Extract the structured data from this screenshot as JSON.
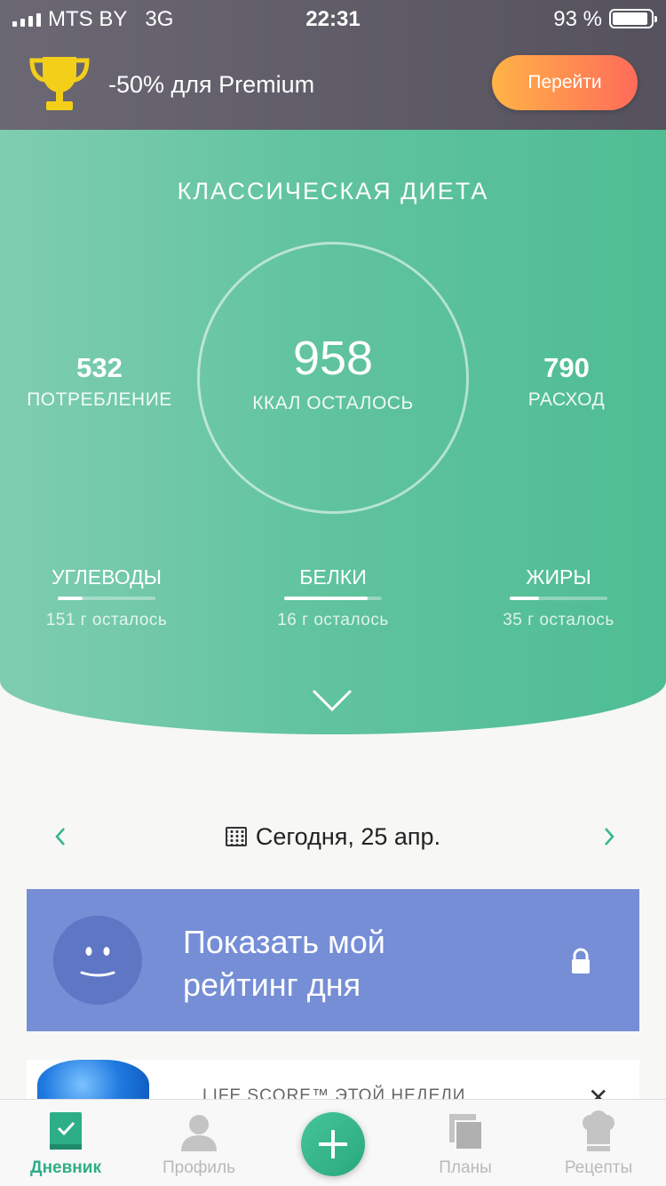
{
  "status_bar": {
    "carrier": "MTS BY",
    "network": "3G",
    "time": "22:31",
    "battery": "93 %"
  },
  "promo": {
    "text": "-50% для Premium",
    "button": "Перейти"
  },
  "summary": {
    "title": "КЛАССИЧЕСКАЯ ДИЕТА",
    "remaining_value": "958",
    "remaining_label": "ККАЛ ОСТАЛОСЬ",
    "intake_value": "532",
    "intake_label": "ПОТРЕБЛЕНИЕ",
    "burned_value": "790",
    "burned_label": "РАСХОД"
  },
  "macros": [
    {
      "name": "УГЛЕВОДЫ",
      "left": "151 г осталось",
      "progress": 0.25
    },
    {
      "name": "БЕЛКИ",
      "left": "16 г осталось",
      "progress": 0.85
    },
    {
      "name": "ЖИРЫ",
      "left": "35 г осталось",
      "progress": 0.3
    }
  ],
  "date": {
    "label": "Сегодня, 25 апр."
  },
  "rating_card": {
    "text": "Показать мой рейтинг дня"
  },
  "next_card": {
    "text": "LIFE SCORE™ ЭТОЙ НЕДЕЛИ"
  },
  "tabs": [
    {
      "label": "Дневник",
      "icon": "diary-icon",
      "active": true
    },
    {
      "label": "Профиль",
      "icon": "profile-icon",
      "active": false
    },
    {
      "label": "Планы",
      "icon": "plans-icon",
      "active": false
    },
    {
      "label": "Рецепты",
      "icon": "recipes-icon",
      "active": false
    }
  ],
  "colors": {
    "accent": "#2eae86",
    "promo_button": "#ff8a50",
    "rating_card": "#768ed6"
  }
}
